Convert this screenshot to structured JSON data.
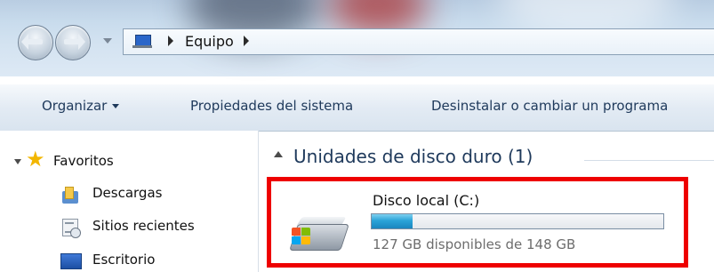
{
  "address_bar": {
    "location_icon": "computer-icon",
    "breadcrumb": "Equipo"
  },
  "toolbar": {
    "organize_label": "Organizar",
    "system_properties_label": "Propiedades del sistema",
    "uninstall_label": "Desinstalar o cambiar un programa"
  },
  "nav_pane": {
    "favorites_label": "Favoritos",
    "items": [
      {
        "label": "Descargas",
        "icon": "downloads-folder-icon"
      },
      {
        "label": "Sitios recientes",
        "icon": "recent-places-icon"
      },
      {
        "label": "Escritorio",
        "icon": "desktop-icon"
      }
    ]
  },
  "content": {
    "section_title": "Unidades de disco duro (1)",
    "drive": {
      "name": "Disco local (C:)",
      "free_text": "127 GB disponibles de 148 GB",
      "used_fraction": 0.14,
      "icon": "hard-drive-windows-icon"
    }
  },
  "colors": {
    "highlight_border": "#ee0000",
    "usage_bar_fill": "#2aa3d8",
    "command_text": "#1e395b"
  }
}
